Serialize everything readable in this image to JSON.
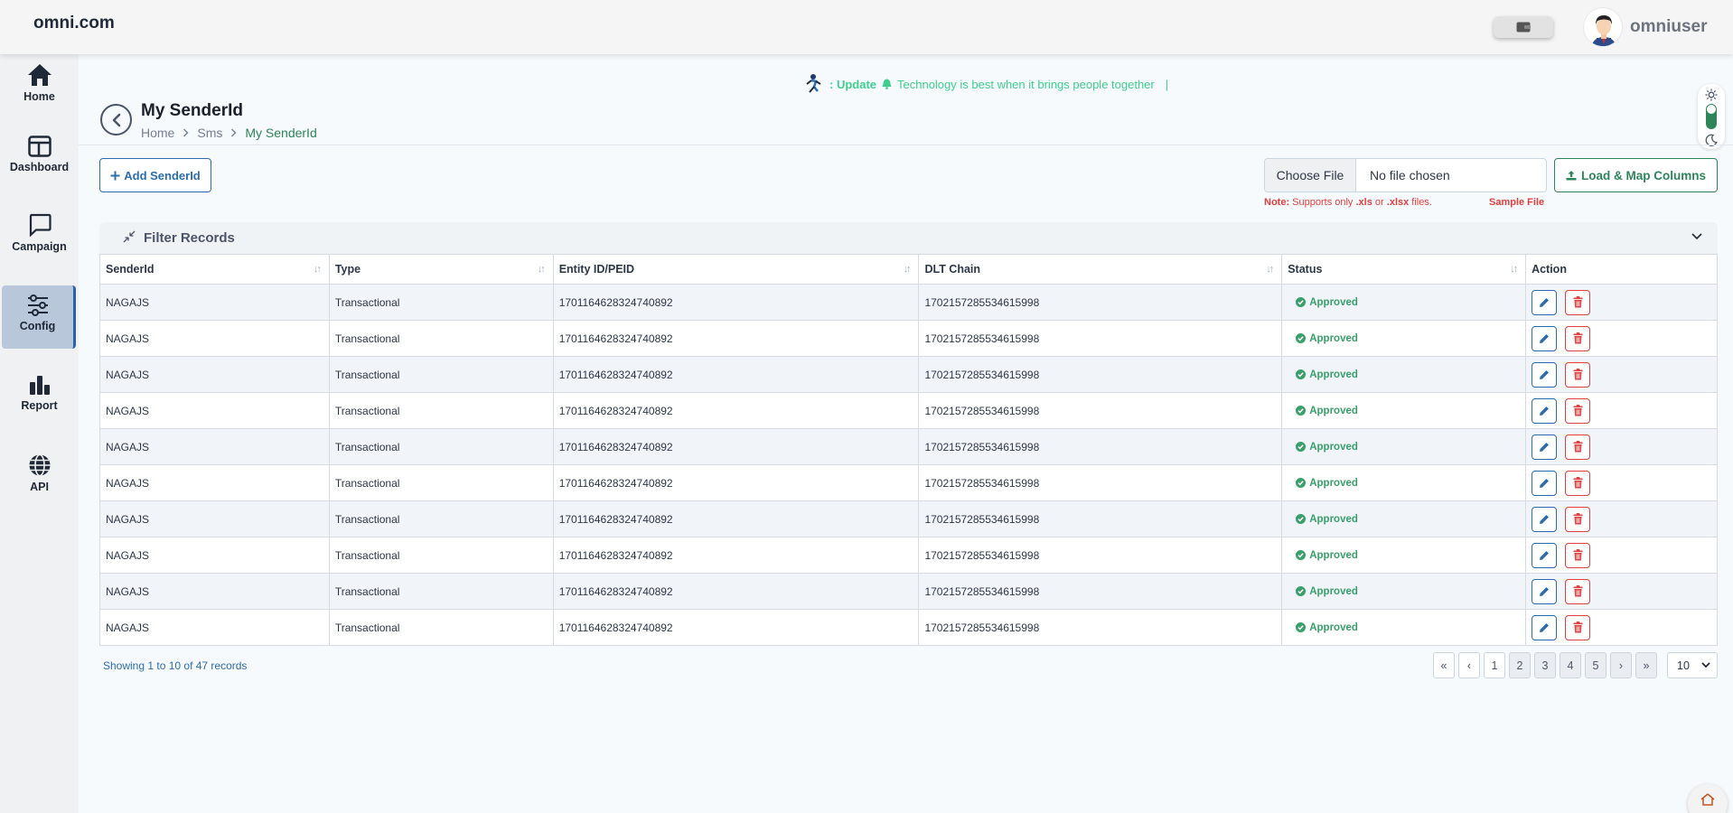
{
  "header": {
    "brand": "omni.com",
    "username": "omniuser"
  },
  "sidebar": {
    "items": [
      {
        "label": "Home",
        "icon": "home-icon"
      },
      {
        "label": "Dashboard",
        "icon": "dashboard-icon"
      },
      {
        "label": "Campaign",
        "icon": "chat-icon"
      },
      {
        "label": "Config",
        "icon": "sliders-icon",
        "active": true
      },
      {
        "label": "Report",
        "icon": "bar-chart-icon"
      },
      {
        "label": "API",
        "icon": "globe-icon"
      }
    ]
  },
  "marquee": {
    "prefix": ": Update",
    "text": "Technology is best when it brings people together",
    "cursor": "|"
  },
  "page": {
    "title": "My SenderId",
    "breadcrumb": [
      "Home",
      "Sms",
      "My SenderId"
    ]
  },
  "toolbar": {
    "add_label": "Add SenderId",
    "choose_file": "Choose File",
    "file_status": "No file chosen",
    "load_label": "Load & Map Columns",
    "note_label": "Note:",
    "note_pre": "Supports only",
    "note_xls": ".xls",
    "note_or": "or",
    "note_xlsx": ".xlsx",
    "note_post": "files.",
    "sample_file": "Sample File"
  },
  "filter": {
    "label": "Filter Records"
  },
  "table": {
    "columns": [
      "SenderId",
      "Type",
      "Entity ID/PEID",
      "DLT Chain",
      "Status",
      "Action"
    ],
    "rows": [
      {
        "senderid": "NAGAJS",
        "type": "Transactional",
        "entity": "1701164628324740892",
        "dlt": "1702157285534615998",
        "status": "Approved"
      },
      {
        "senderid": "NAGAJS",
        "type": "Transactional",
        "entity": "1701164628324740892",
        "dlt": "1702157285534615998",
        "status": "Approved"
      },
      {
        "senderid": "NAGAJS",
        "type": "Transactional",
        "entity": "1701164628324740892",
        "dlt": "1702157285534615998",
        "status": "Approved"
      },
      {
        "senderid": "NAGAJS",
        "type": "Transactional",
        "entity": "1701164628324740892",
        "dlt": "1702157285534615998",
        "status": "Approved"
      },
      {
        "senderid": "NAGAJS",
        "type": "Transactional",
        "entity": "1701164628324740892",
        "dlt": "1702157285534615998",
        "status": "Approved"
      },
      {
        "senderid": "NAGAJS",
        "type": "Transactional",
        "entity": "1701164628324740892",
        "dlt": "1702157285534615998",
        "status": "Approved"
      },
      {
        "senderid": "NAGAJS",
        "type": "Transactional",
        "entity": "1701164628324740892",
        "dlt": "1702157285534615998",
        "status": "Approved"
      },
      {
        "senderid": "NAGAJS",
        "type": "Transactional",
        "entity": "1701164628324740892",
        "dlt": "1702157285534615998",
        "status": "Approved"
      },
      {
        "senderid": "NAGAJS",
        "type": "Transactional",
        "entity": "1701164628324740892",
        "dlt": "1702157285534615998",
        "status": "Approved"
      },
      {
        "senderid": "NAGAJS",
        "type": "Transactional",
        "entity": "1701164628324740892",
        "dlt": "1702157285534615998",
        "status": "Approved"
      }
    ]
  },
  "footer": {
    "showing": "Showing 1 to 10 of 47 records",
    "pager": [
      "«",
      "‹",
      "1",
      "2",
      "3",
      "4",
      "5",
      "›",
      "»"
    ],
    "current_page": "1",
    "page_size": "10"
  },
  "colors": {
    "accent_blue": "#2b6cb0",
    "accent_green": "#2f855a",
    "status_green": "#38a169",
    "danger": "#e53e3e"
  }
}
